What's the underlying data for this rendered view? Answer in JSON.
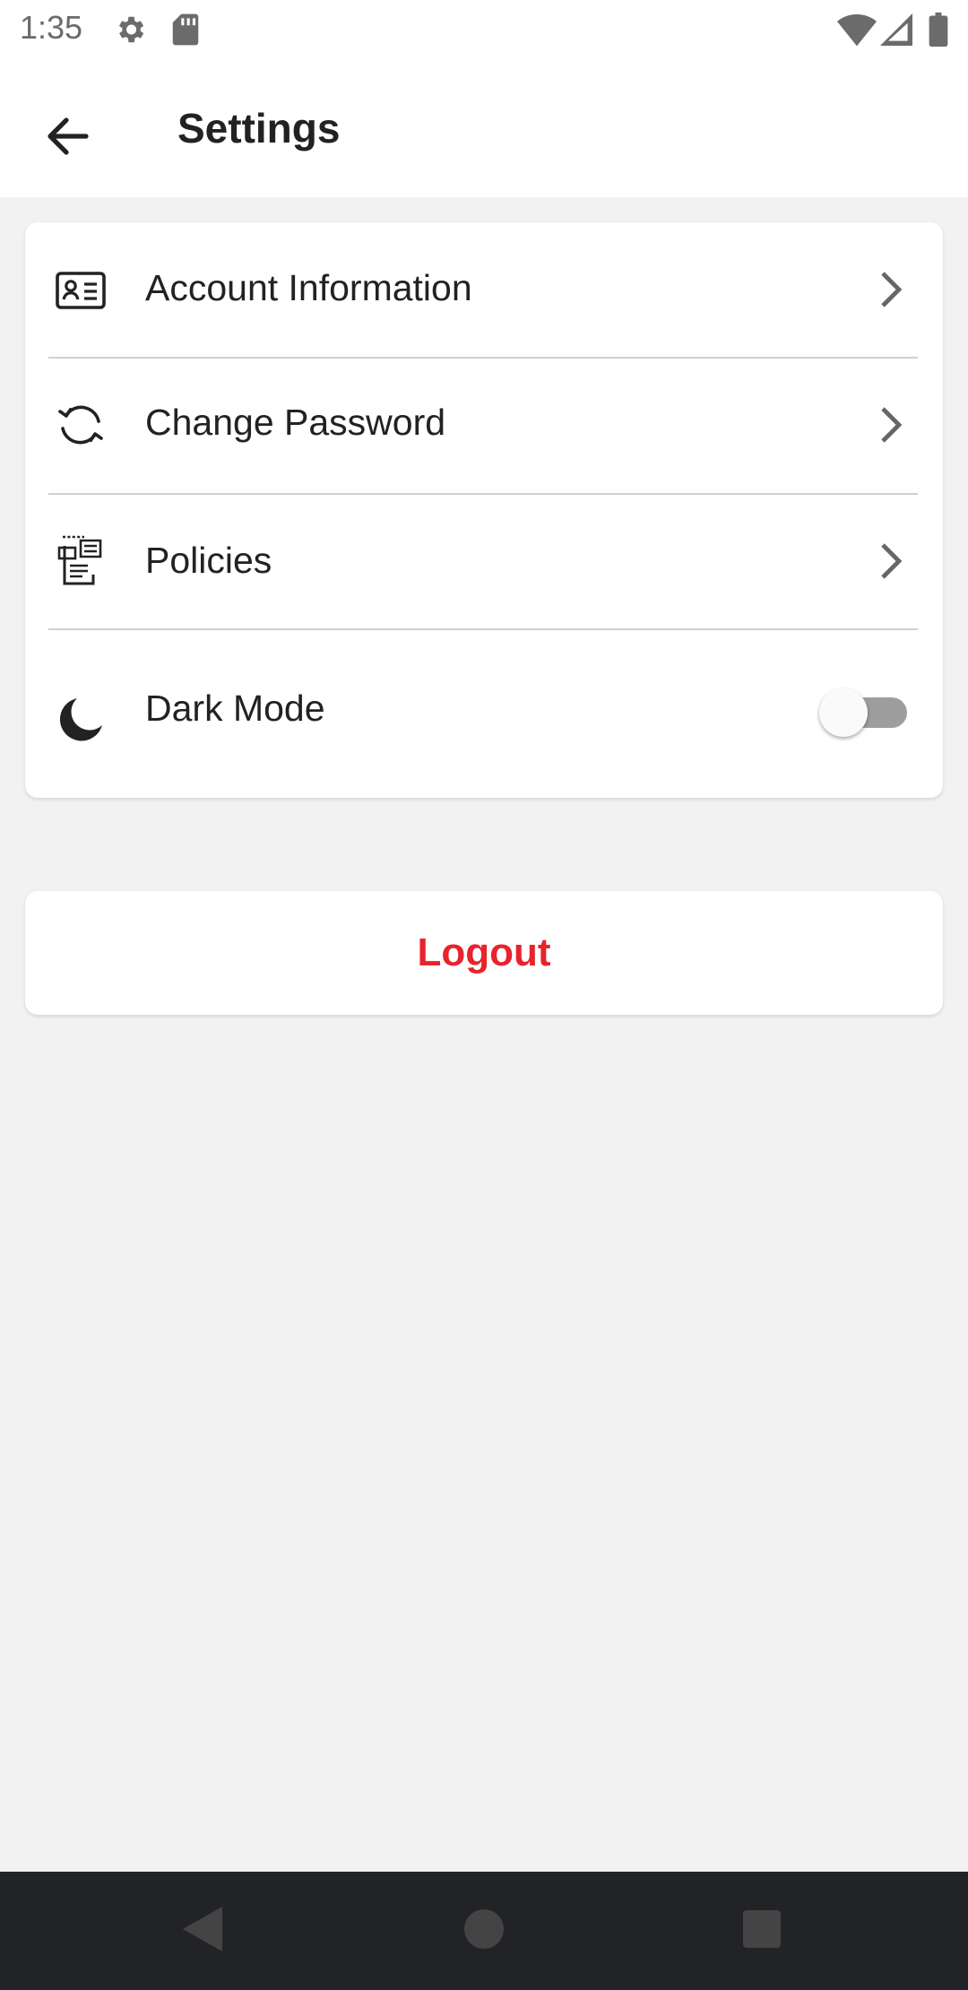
{
  "status_bar": {
    "time": "1:35",
    "left_icons": [
      "gear-icon",
      "sd-card-icon"
    ],
    "right_icons": [
      "wifi-icon",
      "signal-icon",
      "battery-icon"
    ]
  },
  "app_bar": {
    "title": "Settings",
    "back_icon": "arrow-left-icon"
  },
  "settings": {
    "items": [
      {
        "label": "Account Information",
        "icon": "id-card-icon"
      },
      {
        "label": "Change Password",
        "icon": "refresh-icon"
      },
      {
        "label": "Policies",
        "icon": "policy-document-icon"
      },
      {
        "label": "Dark Mode",
        "icon": "moon-icon",
        "toggle": false
      }
    ]
  },
  "logout": {
    "label": "Logout",
    "color": "#e8232b"
  },
  "nav_bar": {
    "buttons": [
      "back-triangle-icon",
      "home-circle-icon",
      "recents-square-icon"
    ]
  },
  "colors": {
    "background": "#f2f2f2",
    "card": "#ffffff",
    "text": "#222222",
    "accent": "#e8232b",
    "nav_bar": "#222327"
  }
}
